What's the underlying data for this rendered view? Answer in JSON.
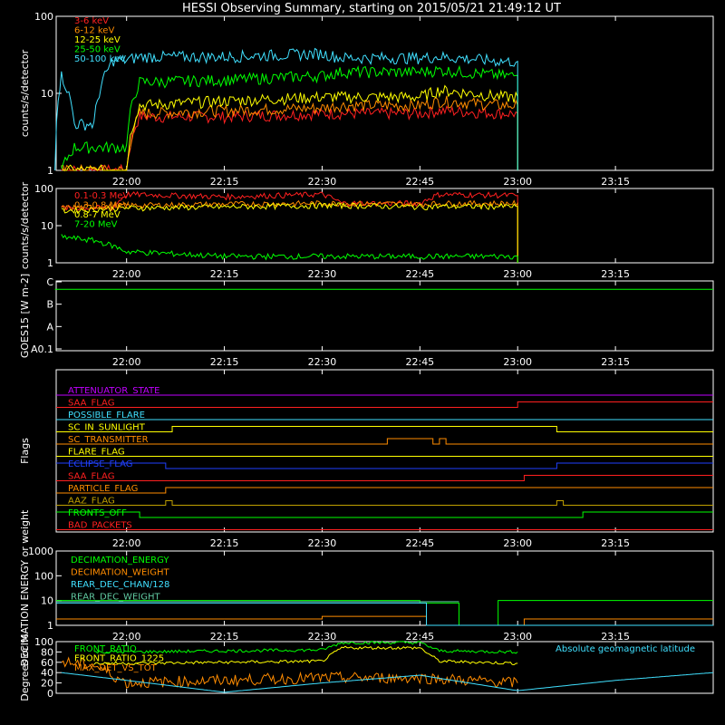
{
  "title": "HESSI Observing Summary, starting on 2015/05/21 21:49:12 UT",
  "time_axis": {
    "start": "21:49:12",
    "end": "23:30",
    "ticks": [
      "22:00",
      "22:15",
      "22:30",
      "22:45",
      "23:00",
      "23:15"
    ]
  },
  "chart_data": [
    {
      "type": "line",
      "id": "low-energy-rates",
      "ylabel": "counts/s/detector",
      "yscale": "log",
      "ylim": [
        1,
        100
      ],
      "ytick_labels": [
        "1",
        "10",
        "100"
      ],
      "series": [
        {
          "name": "3-6 keV",
          "color": "#ff2020",
          "x": [
            "21:50",
            "21:55",
            "22:00",
            "22:02",
            "22:15",
            "22:30",
            "22:33",
            "22:45",
            "22:48",
            "22:58",
            "23:00"
          ],
          "y": [
            1,
            1,
            1,
            5,
            5,
            5.5,
            5.5,
            5.5,
            6,
            5.5,
            5.5
          ]
        },
        {
          "name": "6-12 keV",
          "color": "#ff8c00",
          "x": [
            "21:50",
            "21:55",
            "22:00",
            "22:02",
            "22:15",
            "22:30",
            "22:33",
            "22:45",
            "22:48",
            "22:58",
            "23:00"
          ],
          "y": [
            1,
            1,
            1,
            5.5,
            6,
            6.5,
            7,
            7,
            8,
            7,
            7
          ]
        },
        {
          "name": "12-25 keV",
          "color": "#ffff00",
          "x": [
            "21:50",
            "21:55",
            "22:00",
            "22:02",
            "22:15",
            "22:30",
            "22:33",
            "22:45",
            "22:48",
            "22:58",
            "23:00"
          ],
          "y": [
            1,
            1,
            1,
            7,
            8,
            9,
            9,
            9,
            11,
            9,
            9
          ]
        },
        {
          "name": "25-50 keV",
          "color": "#00ff00",
          "x": [
            "21:50",
            "21:52",
            "21:55",
            "22:00",
            "22:02",
            "22:15",
            "22:30",
            "22:33",
            "22:45",
            "22:48",
            "22:58",
            "23:00"
          ],
          "y": [
            1,
            2,
            2,
            2,
            14,
            15,
            17,
            19,
            19,
            20,
            17,
            17
          ]
        },
        {
          "name": "50-100 keV",
          "color": "#40e0ff",
          "x": [
            "21:49",
            "21:50",
            "21:52",
            "21:55",
            "21:58",
            "22:00",
            "22:02",
            "22:15",
            "22:30",
            "22:33",
            "22:45",
            "22:48",
            "22:58",
            "23:00"
          ],
          "y": [
            1,
            17,
            4,
            4,
            27,
            27,
            30,
            30,
            33,
            29,
            29,
            30,
            26,
            26
          ]
        }
      ]
    },
    {
      "type": "line",
      "id": "high-energy-rates",
      "ylabel": "counts/s/detector",
      "yscale": "log",
      "ylim": [
        1,
        100
      ],
      "ytick_labels": [
        "1",
        "10",
        "100"
      ],
      "series": [
        {
          "name": "0.1-0.3 MeV",
          "color": "#ff2020",
          "x": [
            "21:50",
            "21:58",
            "22:00",
            "22:15",
            "22:30",
            "22:33",
            "22:45",
            "22:48",
            "23:00"
          ],
          "y": [
            30,
            30,
            70,
            60,
            70,
            40,
            40,
            70,
            65
          ]
        },
        {
          "name": "0.3-0.8 MeV",
          "color": "#ff8c00",
          "x": [
            "21:50",
            "22:00",
            "22:15",
            "22:30",
            "22:33",
            "22:45",
            "22:48",
            "23:00"
          ],
          "y": [
            30,
            35,
            38,
            40,
            40,
            38,
            40,
            40
          ]
        },
        {
          "name": "0.8-7 MeV",
          "color": "#ffff00",
          "x": [
            "21:50",
            "22:00",
            "22:15",
            "22:30",
            "22:33",
            "22:45",
            "22:48",
            "23:00"
          ],
          "y": [
            25,
            30,
            32,
            35,
            35,
            32,
            33,
            33
          ]
        },
        {
          "name": "7-20 MeV",
          "color": "#00ff00",
          "x": [
            "21:50",
            "21:55",
            "22:00",
            "22:15",
            "22:30",
            "22:45",
            "23:00"
          ],
          "y": [
            5,
            4,
            2,
            1.5,
            1.5,
            1.5,
            1.5
          ]
        }
      ]
    },
    {
      "type": "line",
      "id": "goes",
      "ylabel": "GOES15 [W m-2]",
      "ytick_labels": [
        "A0.1",
        "A",
        "B",
        "C"
      ],
      "series": [
        {
          "color": "#00ff00",
          "x": [
            "21:49",
            "23:30"
          ],
          "y": [
            0.88,
            0.88
          ]
        }
      ],
      "ylim": [
        0,
        1
      ]
    },
    {
      "type": "line",
      "id": "flags",
      "ylabel": "Flags",
      "series": [
        {
          "name": "ATTENUATOR_STATE",
          "color": "#c000ff"
        },
        {
          "name": "SAA_FLAG",
          "color": "#ff2020"
        },
        {
          "name": "POSSIBLE_FLARE",
          "color": "#40e0ff"
        },
        {
          "name": "SC_IN_SUNLIGHT",
          "color": "#ffff00"
        },
        {
          "name": "SC_TRANSMITTER",
          "color": "#ff8c00"
        },
        {
          "name": "FLARE_FLAG",
          "color": "#ffff00"
        },
        {
          "name": "ECLIPSE_FLAG",
          "color": "#2040ff"
        },
        {
          "name": "SAA_FLAG",
          "color": "#ff2020"
        },
        {
          "name": "PARTICLE_FLAG",
          "color": "#ff8c00"
        },
        {
          "name": "AAZ_FLAG",
          "color": "#c0a000"
        },
        {
          "name": "FRONTS_OFF",
          "color": "#00ff00"
        },
        {
          "name": "BAD_PACKETS",
          "color": "#ff2020"
        }
      ]
    },
    {
      "type": "line",
      "id": "decimation",
      "ylabel": "DECIMATION ENERGY or weight",
      "yscale": "log",
      "ylim": [
        1,
        1000
      ],
      "ytick_labels": [
        "1",
        "10",
        "100",
        "1000"
      ],
      "series": [
        {
          "name": "DECIMATION_ENERGY",
          "color": "#00ff00"
        },
        {
          "name": "DECIMATION_WEIGHT",
          "color": "#ff8c00"
        },
        {
          "name": "REAR_DEC_CHAN/128",
          "color": "#40e0ff"
        },
        {
          "name": "REAR_DEC_WEIGHT",
          "color": "#60c8a0"
        }
      ]
    },
    {
      "type": "line",
      "id": "ratios",
      "ylabel": "Degrees or %",
      "ylim": [
        0,
        100
      ],
      "ytick_labels": [
        "0",
        "20",
        "40",
        "60",
        "80",
        "100"
      ],
      "annotation": "Absolute geomagnetic latitude",
      "series": [
        {
          "name": "FRONT_RATIO",
          "color": "#00ff00",
          "x": [
            "21:55",
            "22:00",
            "22:15",
            "22:30",
            "22:33",
            "22:45",
            "22:48",
            "23:00"
          ],
          "y": [
            80,
            80,
            82,
            84,
            98,
            98,
            82,
            80
          ]
        },
        {
          "name": "FRONT_RATIO_1225",
          "color": "#ffff00",
          "x": [
            "21:55",
            "22:00",
            "22:15",
            "22:30",
            "22:33",
            "22:45",
            "22:48",
            "23:00"
          ],
          "y": [
            58,
            58,
            60,
            62,
            88,
            88,
            62,
            58
          ]
        },
        {
          "name": "MAX_DET_VS_TOT",
          "color": "#ff8c00",
          "x": [
            "21:50",
            "21:55",
            "22:00",
            "22:15",
            "22:30",
            "22:45",
            "23:00"
          ],
          "y": [
            60,
            55,
            20,
            25,
            30,
            30,
            20
          ]
        },
        {
          "name": "Absolute geomagnetic latitude",
          "color": "#40e0ff",
          "x": [
            "21:50",
            "22:00",
            "22:15",
            "22:30",
            "22:45",
            "23:00",
            "23:15",
            "23:30"
          ],
          "y": [
            40,
            25,
            2,
            20,
            35,
            5,
            25,
            40
          ]
        }
      ]
    }
  ]
}
